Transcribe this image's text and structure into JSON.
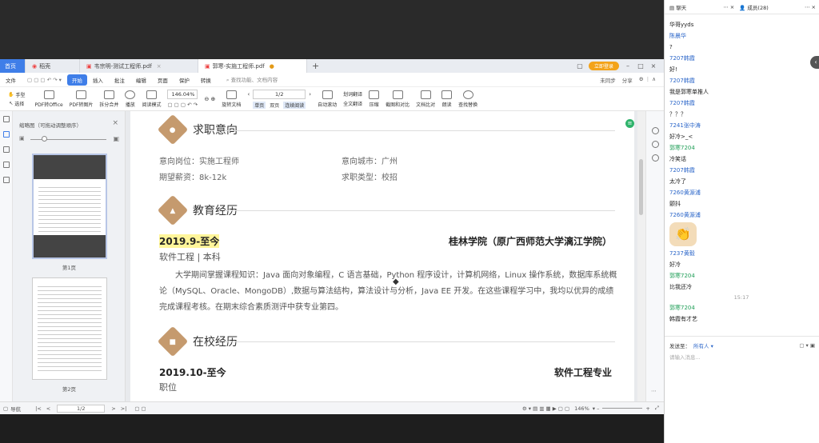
{
  "tabs": [
    {
      "label": "首页"
    },
    {
      "label": "稻壳"
    },
    {
      "label": "韦宗明-测试工程师.pdf"
    },
    {
      "label": "郭寒-实施工程师.pdf"
    }
  ],
  "tabbar": {
    "login": "立即登录"
  },
  "menu": {
    "items": [
      "文件",
      "开始",
      "插入",
      "批注",
      "编辑",
      "页面",
      "保护",
      "转换"
    ],
    "search": "查找功能、文档内容",
    "right": [
      "未同步",
      "分享"
    ]
  },
  "toolbar": {
    "hand": "手型",
    "select": "选择",
    "pdf_to_office": "PDF转Office",
    "pdf_to_image": "PDF转图片",
    "split_merge": "拆分合并",
    "play": "播放",
    "read_mode": "阅读模式",
    "zoom": "146.04%",
    "rotate": "旋转文档",
    "single": "单页",
    "double": "双页",
    "continuous": "连续阅读",
    "auto_scroll": "自动滚动",
    "translate": "划词翻译",
    "full_translate": "全文翻译",
    "compress": "压缩",
    "screenshot": "截图和对比",
    "compare": "文档比对",
    "read": "朗读",
    "find_replace": "查找替换",
    "page": "1/2"
  },
  "thumbs": {
    "title": "缩略图（可拖动调整顺序）",
    "page1": "第1页",
    "page2": "第2页"
  },
  "resume": {
    "sec1": "求职意向",
    "pos_label": "意向岗位：实施工程师",
    "city_label": "意向城市：广州",
    "salary_label": "期望薪资：8k-12k",
    "type_label": "求职类型：校招",
    "sec2": "教育经历",
    "edu_date": "2019.9-至今",
    "edu_school": "桂林学院（原广西师范大学漓江学院）",
    "edu_major": "软件工程 | 本科",
    "edu_desc": "大学期间掌握课程知识：Java 面向对象编程，C 语言基础，Python 程序设计，计算机网络，Linux 操作系统，数据库系统概论（MySQL、Oracle、MongoDB）,数据与算法结构，算法设计与分析，Java EE 开发。在这些课程学习中，我均以优异的成绩完成课程考核。在期末综合素质测评中获专业第四。",
    "sec3": "在校经历",
    "exp_date": "2019.10-至今",
    "exp_org": "软件工程专业",
    "exp_role": "职位"
  },
  "status": {
    "nav": "导航",
    "page": "1/2",
    "zoom": "146%"
  },
  "chat": {
    "tab_chat": "聊天",
    "tab_members": "成员(28)",
    "messages": [
      {
        "type": "text",
        "text": "华哥yyds"
      },
      {
        "type": "name",
        "text": "陈晨华"
      },
      {
        "type": "text",
        "text": "?"
      },
      {
        "type": "name",
        "text": "7207韩霞"
      },
      {
        "type": "text",
        "text": "好!"
      },
      {
        "type": "name",
        "text": "7207韩霞"
      },
      {
        "type": "text",
        "text": "我是郭寒单推人"
      },
      {
        "type": "name",
        "text": "7207韩霞"
      },
      {
        "type": "text",
        "text": "？？？"
      },
      {
        "type": "name",
        "text": "7241张中涛"
      },
      {
        "type": "text",
        "text": "好冷>_<"
      },
      {
        "type": "name-green",
        "text": "郭寒7204"
      },
      {
        "type": "text",
        "text": "冷笑话"
      },
      {
        "type": "name",
        "text": "7207韩霞"
      },
      {
        "type": "text",
        "text": "太冷了"
      },
      {
        "type": "name",
        "text": "7260黄源浦"
      },
      {
        "type": "text",
        "text": "颤抖"
      },
      {
        "type": "name",
        "text": "7260黄源浦"
      },
      {
        "type": "clap",
        "text": "👏"
      },
      {
        "type": "name",
        "text": "7237黄毅"
      },
      {
        "type": "text",
        "text": "好冷"
      },
      {
        "type": "name-green",
        "text": "郭寒7204"
      },
      {
        "type": "text",
        "text": "比我还冷"
      },
      {
        "type": "time",
        "text": "15:17"
      },
      {
        "type": "name-green",
        "text": "郭寒7204"
      },
      {
        "type": "text",
        "text": "韩霞有才艺"
      }
    ],
    "send_to": "发送至：",
    "send_target": "所有人",
    "input_placeholder": "请输入消息..."
  }
}
